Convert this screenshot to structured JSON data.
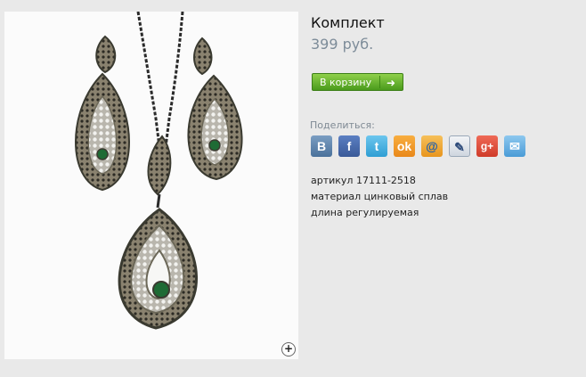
{
  "product": {
    "title": "Комплект",
    "price": "399 руб."
  },
  "cart_button": {
    "label": "В корзину",
    "icon": "arrow-right-icon"
  },
  "share": {
    "label": "Поделиться:",
    "icons": [
      {
        "name": "vkontakte-icon",
        "glyph": "B"
      },
      {
        "name": "facebook-icon",
        "glyph": "f"
      },
      {
        "name": "twitter-icon",
        "glyph": "t"
      },
      {
        "name": "odnoklassniki-icon",
        "glyph": "ok"
      },
      {
        "name": "mailru-icon",
        "glyph": "@"
      },
      {
        "name": "livejournal-icon",
        "glyph": "✎"
      },
      {
        "name": "google-plus-icon",
        "glyph": "g+"
      },
      {
        "name": "email-icon",
        "glyph": "✉"
      }
    ]
  },
  "details": [
    "артикул 17111-2518",
    "материал цинковый сплав",
    "длина регулируемая"
  ],
  "zoom_icon": "zoom-plus-icon"
}
